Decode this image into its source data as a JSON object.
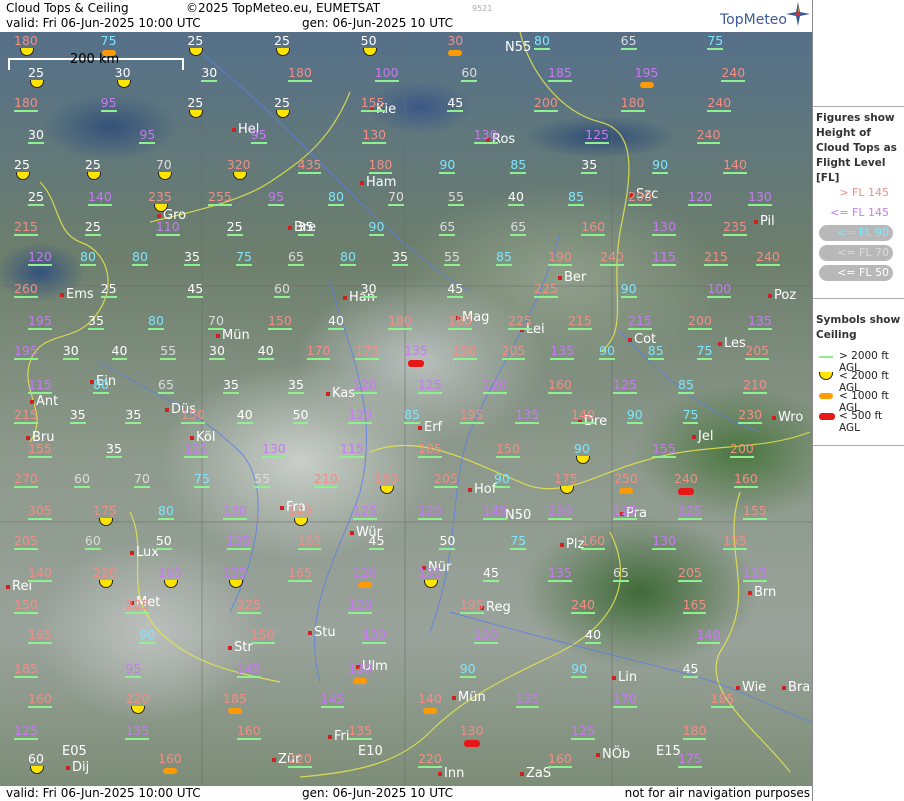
{
  "header": {
    "title": "Cloud Tops & Ceiling",
    "copyright": "©2025 TopMeteo.eu, EUMETSAT",
    "valid": "valid:  Fri  06-Jun-2025  10:00 UTC",
    "gen": "gen: 06-Jun-2025 10 UTC",
    "code": "9521",
    "logo": "TopMeteo"
  },
  "footer": {
    "valid": "valid:  Fri  06-Jun-2025  10:00 UTC",
    "gen": "gen: 06-Jun-2025 10 UTC",
    "note": "not for air navigation purposes"
  },
  "scale_label": "200 km",
  "legend": {
    "figures_title": "Figures show Height of Cloud Tops as Flight Level  [FL]",
    "levels": [
      {
        "text": "> FL 145",
        "color": "#f08f86"
      },
      {
        "text": "<= FL 145",
        "color": "#c67bf0"
      },
      {
        "text": "<= FL 90",
        "color": "#7de6ff"
      },
      {
        "text": "<= FL 70",
        "color": "#dcdcdc"
      },
      {
        "text": "<= FL 50",
        "color": "#ffffff"
      }
    ],
    "symbols_title": "Symbols show Ceiling",
    "symbols": [
      {
        "text": "> 2000 ft AGL",
        "kind": "line",
        "color": "#8ff08f"
      },
      {
        "text": "< 2000 ft AGL",
        "kind": "yellow",
        "color": "#ffe500"
      },
      {
        "text": "< 1000 ft AGL",
        "kind": "orange",
        "color": "#ff9a00"
      },
      {
        "text": "< 500 ft AGL",
        "kind": "red",
        "color": "#e81818"
      }
    ]
  },
  "cities": [
    {
      "name": "Hel"
    },
    {
      "name": "Kie"
    },
    {
      "name": "Ros"
    },
    {
      "name": "Ham"
    },
    {
      "name": "Szc"
    },
    {
      "name": "Gro"
    },
    {
      "name": "Bre"
    },
    {
      "name": "Pil"
    },
    {
      "name": "Ber"
    },
    {
      "name": "Poz"
    },
    {
      "name": "Ems"
    },
    {
      "name": "Han"
    },
    {
      "name": "Mag"
    },
    {
      "name": "Lei"
    },
    {
      "name": "Cot"
    },
    {
      "name": "Mün"
    },
    {
      "name": "Les"
    },
    {
      "name": "Ein"
    },
    {
      "name": "Kas"
    },
    {
      "name": "Ant"
    },
    {
      "name": "Düs"
    },
    {
      "name": "Dre"
    },
    {
      "name": "Wro"
    },
    {
      "name": "Bru"
    },
    {
      "name": "Köl"
    },
    {
      "name": "Erf"
    },
    {
      "name": "Jel"
    },
    {
      "name": "Hof"
    },
    {
      "name": "Fra"
    },
    {
      "name": "Pra"
    },
    {
      "name": "Lux"
    },
    {
      "name": "Wür"
    },
    {
      "name": "Plz"
    },
    {
      "name": "Nür"
    },
    {
      "name": "Rei"
    },
    {
      "name": "Met"
    },
    {
      "name": "Reg"
    },
    {
      "name": "Brn"
    },
    {
      "name": "Stu"
    },
    {
      "name": "Str"
    },
    {
      "name": "Ulm"
    },
    {
      "name": "Lin"
    },
    {
      "name": "Mün"
    },
    {
      "name": "Wie"
    },
    {
      "name": "Bra"
    },
    {
      "name": "Fri"
    },
    {
      "name": "Inn"
    },
    {
      "name": "ZaS"
    },
    {
      "name": "NÖb"
    },
    {
      "name": "Dij"
    },
    {
      "name": "Zür"
    },
    {
      "name": "N55"
    },
    {
      "name": "N50"
    },
    {
      "name": "E05"
    },
    {
      "name": "E10"
    },
    {
      "name": "E15"
    }
  ],
  "labels": [
    [
      "180",
      "p",
      "y"
    ],
    [
      "75",
      "c",
      "o"
    ],
    [
      "25",
      "w",
      "y"
    ],
    [
      "25",
      "w",
      "y"
    ],
    [
      "50",
      "w",
      "y"
    ],
    [
      "30",
      "p",
      "o"
    ],
    [
      "80",
      "c",
      ""
    ],
    [
      "65",
      "g",
      ""
    ],
    [
      "75",
      "c",
      ""
    ],
    [
      "25",
      "w",
      "y"
    ],
    [
      "30",
      "w",
      "y"
    ],
    [
      "30",
      "w",
      ""
    ],
    [
      "180",
      "p",
      ""
    ],
    [
      "100",
      "v",
      ""
    ],
    [
      "60",
      "g",
      ""
    ],
    [
      "185",
      "v",
      ""
    ],
    [
      "195",
      "v",
      "o"
    ],
    [
      "240",
      "p",
      ""
    ],
    [
      "180",
      "p",
      ""
    ],
    [
      "95",
      "v",
      ""
    ],
    [
      "25",
      "w",
      "y"
    ],
    [
      "25",
      "w",
      "y"
    ],
    [
      "155",
      "p",
      ""
    ],
    [
      "45",
      "w",
      ""
    ],
    [
      "200",
      "p",
      ""
    ],
    [
      "180",
      "p",
      ""
    ],
    [
      "240",
      "p",
      ""
    ],
    [
      "30",
      "w",
      ""
    ],
    [
      "95",
      "v",
      ""
    ],
    [
      "95",
      "v",
      ""
    ],
    [
      "130",
      "p",
      ""
    ],
    [
      "130",
      "v",
      ""
    ],
    [
      "125",
      "v",
      ""
    ],
    [
      "240",
      "p",
      ""
    ],
    [
      "25",
      "w",
      "y"
    ],
    [
      "25",
      "w",
      "y"
    ],
    [
      "70",
      "g",
      "y"
    ],
    [
      "320",
      "p",
      "y"
    ],
    [
      "435",
      "p",
      ""
    ],
    [
      "180",
      "p",
      ""
    ],
    [
      "90",
      "c",
      ""
    ],
    [
      "85",
      "c",
      ""
    ],
    [
      "35",
      "w",
      ""
    ],
    [
      "90",
      "c",
      ""
    ],
    [
      "140",
      "p",
      ""
    ],
    [
      "25",
      "w",
      ""
    ],
    [
      "140",
      "v",
      ""
    ],
    [
      "235",
      "p",
      "y"
    ],
    [
      "255",
      "p",
      ""
    ],
    [
      "95",
      "v",
      ""
    ],
    [
      "80",
      "c",
      ""
    ],
    [
      "70",
      "g",
      ""
    ],
    [
      "55",
      "g",
      ""
    ],
    [
      "40",
      "w",
      ""
    ],
    [
      "85",
      "c",
      ""
    ],
    [
      "200",
      "p",
      ""
    ],
    [
      "120",
      "v",
      ""
    ],
    [
      "130",
      "v",
      ""
    ],
    [
      "215",
      "p",
      ""
    ],
    [
      "25",
      "w",
      ""
    ],
    [
      "110",
      "v",
      ""
    ],
    [
      "25",
      "w",
      ""
    ],
    [
      "35",
      "w",
      ""
    ],
    [
      "90",
      "c",
      ""
    ],
    [
      "65",
      "g",
      ""
    ],
    [
      "65",
      "g",
      ""
    ],
    [
      "160",
      "p",
      ""
    ],
    [
      "130",
      "v",
      ""
    ],
    [
      "235",
      "p",
      ""
    ],
    [
      "120",
      "v",
      ""
    ],
    [
      "80",
      "c",
      ""
    ],
    [
      "80",
      "c",
      ""
    ],
    [
      "35",
      "w",
      ""
    ],
    [
      "75",
      "c",
      ""
    ],
    [
      "65",
      "g",
      ""
    ],
    [
      "80",
      "c",
      ""
    ],
    [
      "35",
      "w",
      ""
    ],
    [
      "55",
      "g",
      ""
    ],
    [
      "85",
      "c",
      ""
    ],
    [
      "190",
      "p",
      ""
    ],
    [
      "240",
      "p",
      ""
    ],
    [
      "115",
      "v",
      ""
    ],
    [
      "215",
      "p",
      ""
    ],
    [
      "240",
      "p",
      ""
    ],
    [
      "260",
      "p",
      ""
    ],
    [
      "25",
      "w",
      ""
    ],
    [
      "45",
      "w",
      ""
    ],
    [
      "60",
      "g",
      ""
    ],
    [
      "30",
      "w",
      ""
    ],
    [
      "45",
      "w",
      ""
    ],
    [
      "225",
      "p",
      ""
    ],
    [
      "90",
      "c",
      ""
    ],
    [
      "100",
      "v",
      ""
    ],
    [
      "195",
      "v",
      ""
    ],
    [
      "35",
      "w",
      ""
    ],
    [
      "80",
      "c",
      ""
    ],
    [
      "70",
      "g",
      ""
    ],
    [
      "150",
      "p",
      ""
    ],
    [
      "40",
      "w",
      ""
    ],
    [
      "180",
      "p",
      ""
    ],
    [
      "180",
      "p",
      ""
    ],
    [
      "225",
      "p",
      ""
    ],
    [
      "215",
      "p",
      ""
    ],
    [
      "215",
      "v",
      ""
    ],
    [
      "200",
      "p",
      ""
    ],
    [
      "135",
      "v",
      ""
    ],
    [
      "195",
      "v",
      ""
    ],
    [
      "30",
      "w",
      ""
    ],
    [
      "40",
      "w",
      ""
    ],
    [
      "55",
      "g",
      ""
    ],
    [
      "30",
      "w",
      ""
    ],
    [
      "40",
      "w",
      ""
    ],
    [
      "170",
      "p",
      ""
    ],
    [
      "175",
      "p",
      ""
    ],
    [
      "135",
      "v",
      "r"
    ],
    [
      "150",
      "p",
      ""
    ],
    [
      "205",
      "p",
      ""
    ],
    [
      "135",
      "v",
      ""
    ],
    [
      "90",
      "c",
      ""
    ],
    [
      "85",
      "c",
      ""
    ],
    [
      "75",
      "c",
      ""
    ],
    [
      "205",
      "p",
      ""
    ],
    [
      "115",
      "v",
      ""
    ],
    [
      "80",
      "c",
      ""
    ],
    [
      "65",
      "g",
      ""
    ],
    [
      "35",
      "w",
      ""
    ],
    [
      "35",
      "w",
      ""
    ],
    [
      "120",
      "v",
      ""
    ],
    [
      "125",
      "v",
      ""
    ],
    [
      "120",
      "v",
      ""
    ],
    [
      "160",
      "p",
      ""
    ],
    [
      "125",
      "v",
      ""
    ],
    [
      "85",
      "c",
      ""
    ],
    [
      "210",
      "p",
      ""
    ],
    [
      "215",
      "p",
      ""
    ],
    [
      "35",
      "w",
      ""
    ],
    [
      "35",
      "w",
      ""
    ],
    [
      "150",
      "p",
      ""
    ],
    [
      "40",
      "w",
      ""
    ],
    [
      "50",
      "w",
      ""
    ],
    [
      "120",
      "v",
      ""
    ],
    [
      "85",
      "c",
      ""
    ],
    [
      "195",
      "p",
      ""
    ],
    [
      "135",
      "v",
      ""
    ],
    [
      "140",
      "p",
      ""
    ],
    [
      "90",
      "c",
      ""
    ],
    [
      "75",
      "c",
      ""
    ],
    [
      "230",
      "p",
      ""
    ],
    [
      "155",
      "p",
      ""
    ],
    [
      "35",
      "w",
      ""
    ],
    [
      "125",
      "v",
      ""
    ],
    [
      "130",
      "v",
      ""
    ],
    [
      "115",
      "v",
      ""
    ],
    [
      "185",
      "p",
      ""
    ],
    [
      "150",
      "p",
      ""
    ],
    [
      "90",
      "c",
      "y"
    ],
    [
      "155",
      "v",
      ""
    ],
    [
      "200",
      "p",
      ""
    ],
    [
      "270",
      "p",
      ""
    ],
    [
      "60",
      "g",
      ""
    ],
    [
      "70",
      "g",
      ""
    ],
    [
      "75",
      "c",
      ""
    ],
    [
      "55",
      "g",
      ""
    ],
    [
      "210",
      "p",
      ""
    ],
    [
      "180",
      "p",
      "y"
    ],
    [
      "205",
      "p",
      ""
    ],
    [
      "90",
      "c",
      ""
    ],
    [
      "175",
      "p",
      "y"
    ],
    [
      "250",
      "p",
      "o"
    ],
    [
      "240",
      "p",
      "r"
    ],
    [
      "160",
      "p",
      ""
    ],
    [
      "305",
      "p",
      ""
    ],
    [
      "175",
      "p",
      "y"
    ],
    [
      "80",
      "c",
      ""
    ],
    [
      "130",
      "v",
      ""
    ],
    [
      "140",
      "p",
      "y"
    ],
    [
      "125",
      "v",
      ""
    ],
    [
      "120",
      "v",
      ""
    ],
    [
      "145",
      "v",
      ""
    ],
    [
      "130",
      "v",
      ""
    ],
    [
      "125",
      "v",
      ""
    ],
    [
      "125",
      "v",
      ""
    ],
    [
      "155",
      "p",
      ""
    ],
    [
      "205",
      "p",
      ""
    ],
    [
      "60",
      "g",
      ""
    ],
    [
      "50",
      "w",
      ""
    ],
    [
      "135",
      "v",
      ""
    ],
    [
      "165",
      "p",
      ""
    ],
    [
      "45",
      "w",
      ""
    ],
    [
      "50",
      "w",
      ""
    ],
    [
      "75",
      "c",
      ""
    ],
    [
      "160",
      "p",
      ""
    ],
    [
      "130",
      "v",
      ""
    ],
    [
      "155",
      "p",
      ""
    ],
    [
      "140",
      "p",
      ""
    ],
    [
      "220",
      "p",
      "y"
    ],
    [
      "165",
      "v",
      "y"
    ],
    [
      "155",
      "v",
      "y"
    ],
    [
      "165",
      "p",
      ""
    ],
    [
      "120",
      "v",
      "o"
    ],
    [
      "135",
      "v",
      "y"
    ],
    [
      "45",
      "w",
      ""
    ],
    [
      "135",
      "v",
      ""
    ],
    [
      "65",
      "g",
      ""
    ],
    [
      "205",
      "p",
      ""
    ],
    [
      "115",
      "v",
      ""
    ],
    [
      "150",
      "p",
      ""
    ],
    [
      "225",
      "p",
      ""
    ],
    [
      "225",
      "p",
      ""
    ],
    [
      "120",
      "v",
      ""
    ],
    [
      "195",
      "p",
      ""
    ],
    [
      "240",
      "p",
      ""
    ],
    [
      "165",
      "p",
      ""
    ],
    [
      "165",
      "p",
      ""
    ],
    [
      "90",
      "c",
      ""
    ],
    [
      "150",
      "p",
      ""
    ],
    [
      "130",
      "v",
      ""
    ],
    [
      "130",
      "v",
      ""
    ],
    [
      "40",
      "w",
      ""
    ],
    [
      "140",
      "v",
      ""
    ],
    [
      "185",
      "p",
      ""
    ],
    [
      "95",
      "v",
      ""
    ],
    [
      "145",
      "v",
      ""
    ],
    [
      "130",
      "v",
      "o"
    ],
    [
      "90",
      "c",
      ""
    ],
    [
      "90",
      "c",
      ""
    ],
    [
      "45",
      "w",
      ""
    ],
    [
      "160",
      "p",
      ""
    ],
    [
      "220",
      "p",
      "y"
    ],
    [
      "185",
      "p",
      "o"
    ],
    [
      "145",
      "v",
      ""
    ],
    [
      "140",
      "p",
      "o"
    ],
    [
      "135",
      "v",
      ""
    ],
    [
      "170",
      "v",
      ""
    ],
    [
      "185",
      "p",
      ""
    ],
    [
      "125",
      "v",
      ""
    ],
    [
      "135",
      "v",
      ""
    ],
    [
      "160",
      "p",
      ""
    ],
    [
      "135",
      "p",
      ""
    ],
    [
      "130",
      "p",
      "r"
    ],
    [
      "125",
      "v",
      ""
    ],
    [
      "180",
      "p",
      ""
    ],
    [
      "60",
      "w",
      "y"
    ],
    [
      "160",
      "p",
      "o"
    ],
    [
      "220",
      "p",
      ""
    ],
    [
      "220",
      "p",
      ""
    ],
    [
      "160",
      "p",
      ""
    ],
    [
      "175",
      "v",
      ""
    ],
    [
      "180",
      "p",
      ""
    ]
  ]
}
